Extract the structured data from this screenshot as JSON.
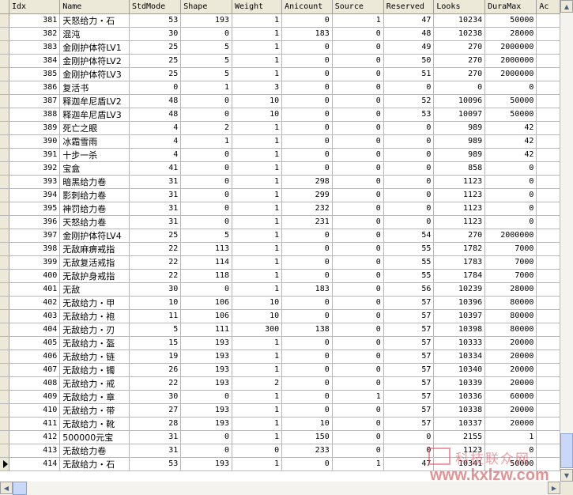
{
  "columns": [
    "Idx",
    "Name",
    "StdMode",
    "Shape",
    "Weight",
    "Anicount",
    "Source",
    "Reserved",
    "Looks",
    "DuraMax",
    "Ac"
  ],
  "rows": [
    [
      "381",
      "天怒给力・石",
      "53",
      "193",
      "1",
      "0",
      "1",
      "47",
      "10234",
      "50000"
    ],
    [
      "382",
      "混沌",
      "30",
      "0",
      "1",
      "183",
      "0",
      "48",
      "10238",
      "28000"
    ],
    [
      "383",
      "金刚护体符LV1",
      "25",
      "5",
      "1",
      "0",
      "0",
      "49",
      "270",
      "2000000"
    ],
    [
      "384",
      "金刚护体符LV2",
      "25",
      "5",
      "1",
      "0",
      "0",
      "50",
      "270",
      "2000000"
    ],
    [
      "385",
      "金刚护体符LV3",
      "25",
      "5",
      "1",
      "0",
      "0",
      "51",
      "270",
      "2000000"
    ],
    [
      "386",
      "复活书",
      "0",
      "1",
      "3",
      "0",
      "0",
      "0",
      "0",
      "0"
    ],
    [
      "387",
      "释迦牟尼盾LV2",
      "48",
      "0",
      "10",
      "0",
      "0",
      "52",
      "10096",
      "50000"
    ],
    [
      "388",
      "释迦牟尼盾LV3",
      "48",
      "0",
      "10",
      "0",
      "0",
      "53",
      "10097",
      "50000"
    ],
    [
      "389",
      "死亡之眼",
      "4",
      "2",
      "1",
      "0",
      "0",
      "0",
      "989",
      "42"
    ],
    [
      "390",
      "冰霜雪雨",
      "4",
      "1",
      "1",
      "0",
      "0",
      "0",
      "989",
      "42"
    ],
    [
      "391",
      "十步一杀",
      "4",
      "0",
      "1",
      "0",
      "0",
      "0",
      "989",
      "42"
    ],
    [
      "392",
      "宝盒",
      "41",
      "0",
      "1",
      "0",
      "0",
      "0",
      "858",
      "0"
    ],
    [
      "393",
      "暗黑给力卷",
      "31",
      "0",
      "1",
      "298",
      "0",
      "0",
      "1123",
      "0"
    ],
    [
      "394",
      "影刺给力卷",
      "31",
      "0",
      "1",
      "299",
      "0",
      "0",
      "1123",
      "0"
    ],
    [
      "395",
      "神罚给力卷",
      "31",
      "0",
      "1",
      "232",
      "0",
      "0",
      "1123",
      "0"
    ],
    [
      "396",
      "天怒给力卷",
      "31",
      "0",
      "1",
      "231",
      "0",
      "0",
      "1123",
      "0"
    ],
    [
      "397",
      "金刚护体符LV4",
      "25",
      "5",
      "1",
      "0",
      "0",
      "54",
      "270",
      "2000000"
    ],
    [
      "398",
      "无敌麻痹戒指",
      "22",
      "113",
      "1",
      "0",
      "0",
      "55",
      "1782",
      "7000"
    ],
    [
      "399",
      "无敌复活戒指",
      "22",
      "114",
      "1",
      "0",
      "0",
      "55",
      "1783",
      "7000"
    ],
    [
      "400",
      "无敌护身戒指",
      "22",
      "118",
      "1",
      "0",
      "0",
      "55",
      "1784",
      "7000"
    ],
    [
      "401",
      "无敌",
      "30",
      "0",
      "1",
      "183",
      "0",
      "56",
      "10239",
      "28000"
    ],
    [
      "402",
      "无敌给力・甲",
      "10",
      "106",
      "10",
      "0",
      "0",
      "57",
      "10396",
      "80000"
    ],
    [
      "403",
      "无敌给力・袍",
      "11",
      "106",
      "10",
      "0",
      "0",
      "57",
      "10397",
      "80000"
    ],
    [
      "404",
      "无敌给力・刃",
      "5",
      "111",
      "300",
      "138",
      "0",
      "57",
      "10398",
      "80000"
    ],
    [
      "405",
      "无敌给力・盔",
      "15",
      "193",
      "1",
      "0",
      "0",
      "57",
      "10333",
      "20000"
    ],
    [
      "406",
      "无敌给力・链",
      "19",
      "193",
      "1",
      "0",
      "0",
      "57",
      "10334",
      "20000"
    ],
    [
      "407",
      "无敌给力・镯",
      "26",
      "193",
      "1",
      "0",
      "0",
      "57",
      "10340",
      "20000"
    ],
    [
      "408",
      "无敌给力・戒",
      "22",
      "193",
      "2",
      "0",
      "0",
      "57",
      "10339",
      "20000"
    ],
    [
      "409",
      "无敌给力・章",
      "30",
      "0",
      "1",
      "0",
      "1",
      "57",
      "10336",
      "60000"
    ],
    [
      "410",
      "无敌给力・带",
      "27",
      "193",
      "1",
      "0",
      "0",
      "57",
      "10338",
      "20000"
    ],
    [
      "411",
      "无敌给力・靴",
      "28",
      "193",
      "1",
      "10",
      "0",
      "57",
      "10337",
      "20000"
    ],
    [
      "412",
      "500000元宝",
      "31",
      "0",
      "1",
      "150",
      "0",
      "0",
      "2155",
      "1"
    ],
    [
      "413",
      "无敌给力卷",
      "31",
      "0",
      "0",
      "233",
      "0",
      "0",
      "1123",
      "0"
    ],
    [
      "414",
      "无敌给力・石",
      "53",
      "193",
      "1",
      "0",
      "1",
      "47",
      "10341",
      "50000"
    ]
  ],
  "current_row": 33,
  "scrollbar": {
    "up": "▲",
    "down": "▼",
    "left": "◀",
    "right": "▶"
  },
  "watermark": {
    "line1": "科技联众网",
    "line2": "www.kxlzw.com"
  }
}
